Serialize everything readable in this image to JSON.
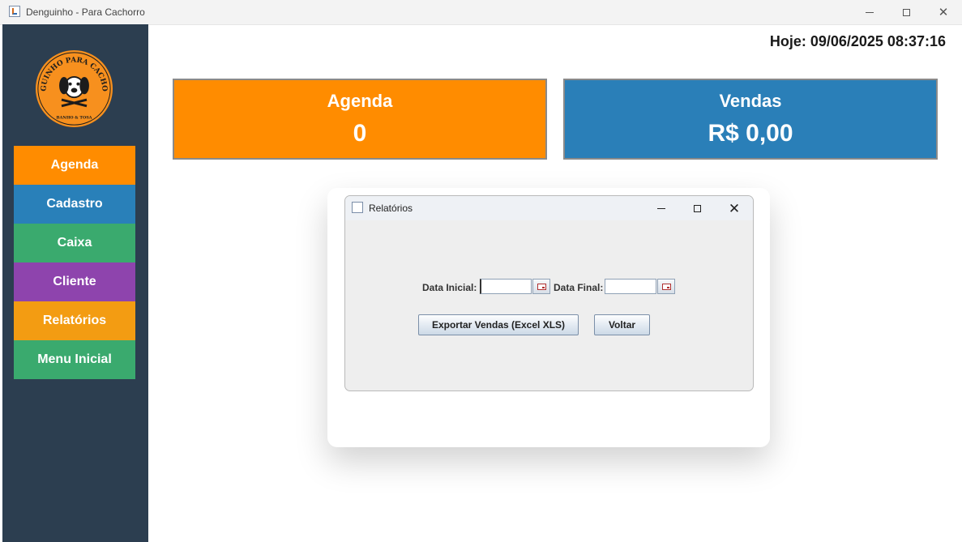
{
  "window": {
    "title": "Denguinho - Para Cachorro"
  },
  "logo": {
    "top_text": "DENGUINHO PARA CACHORRO",
    "bottom_text": "BANHO & TOSA"
  },
  "sidebar": {
    "items": [
      {
        "label": "Agenda",
        "color": "#ff8c00"
      },
      {
        "label": "Cadastro",
        "color": "#2980b9"
      },
      {
        "label": "Caixa",
        "color": "#3aaa6e"
      },
      {
        "label": "Cliente",
        "color": "#8e44ad"
      },
      {
        "label": "Relatórios",
        "color": "#f39c12"
      },
      {
        "label": "Menu Inicial",
        "color": "#3aaa6e"
      }
    ]
  },
  "header": {
    "today": "Hoje: 09/06/2025 08:37:16"
  },
  "cards": {
    "agenda": {
      "title": "Agenda",
      "value": "0",
      "color": "#ff8c00"
    },
    "vendas": {
      "title": "Vendas",
      "value": "R$ 0,00",
      "color": "#2a7fb8"
    }
  },
  "dialog": {
    "title": "Relatórios",
    "data_inicial_label": "Data Inicial:",
    "data_inicial_value": "",
    "data_final_label": "Data Final:",
    "data_final_value": "",
    "export_label": "Exportar Vendas (Excel XLS)",
    "voltar_label": "Voltar"
  },
  "icons": {
    "app": "java-cup-icon",
    "minimize": "minimize-icon",
    "maximize": "maximize-icon",
    "close": "close-icon",
    "calendar": "calendar-icon"
  }
}
